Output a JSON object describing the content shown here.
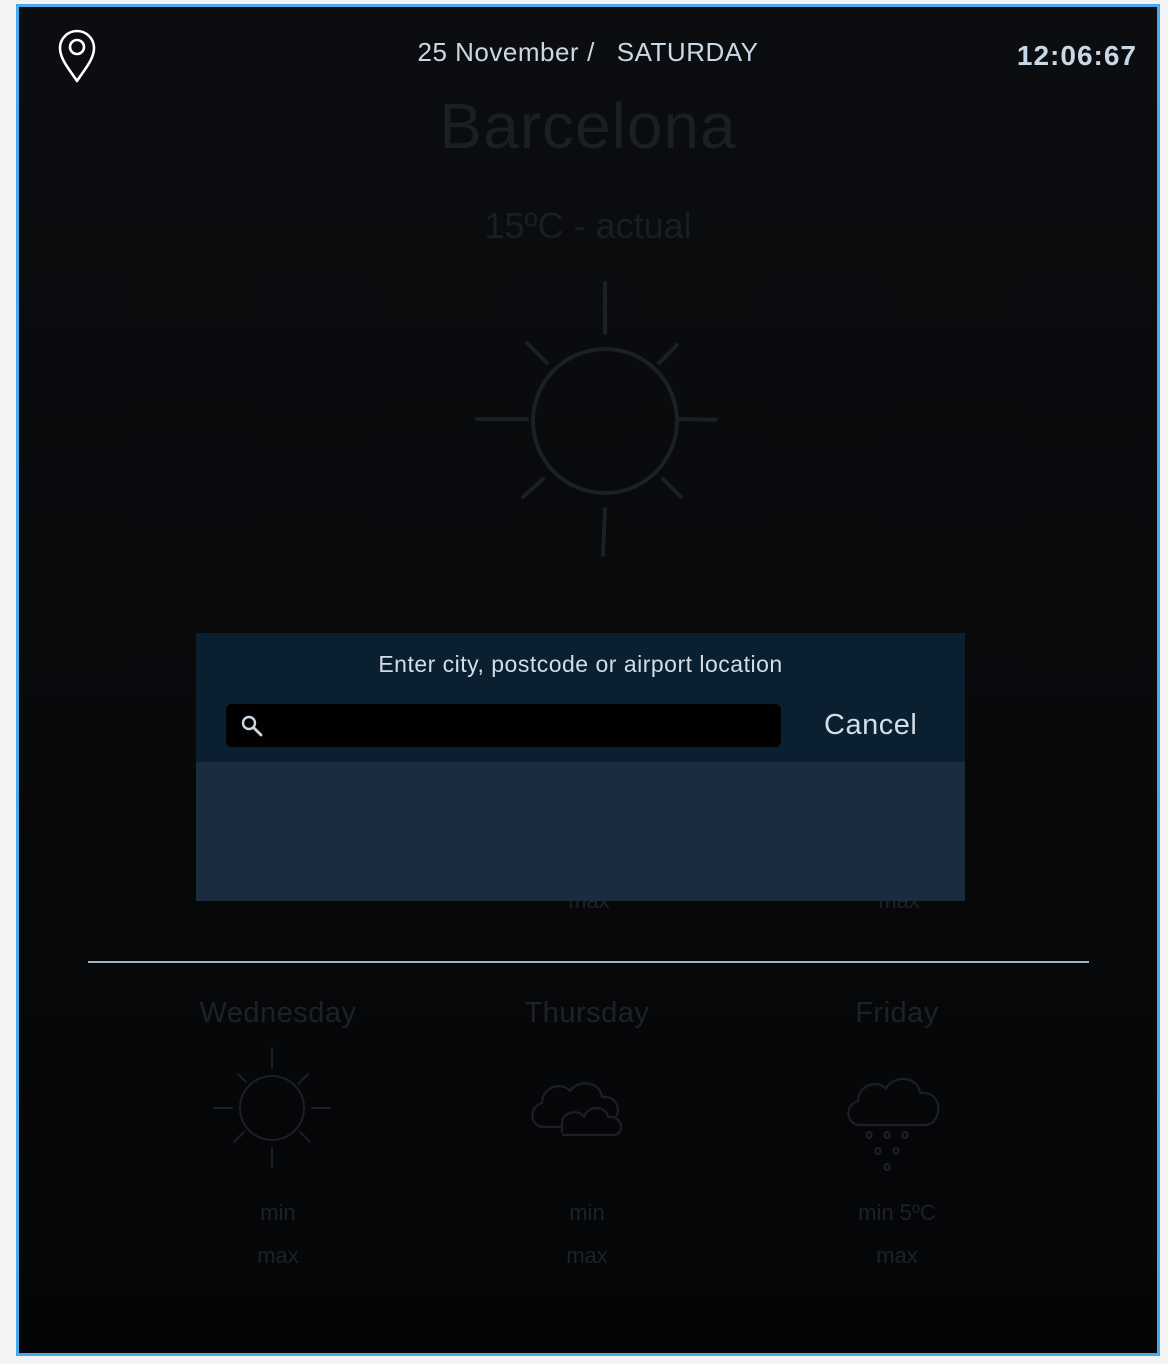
{
  "header": {
    "date": "25 November",
    "separator": "/",
    "day": "SATURDAY",
    "clock": "12:06:67"
  },
  "current": {
    "city": "Barcelona",
    "temperature": "15ºC - actual",
    "condition_icon": "sun-icon"
  },
  "search_modal": {
    "title": "Enter city, postcode or airport location",
    "search_value": "",
    "cancel_label": "Cancel"
  },
  "hidden_labels": {
    "left": "max",
    "right": "max"
  },
  "forecast": [
    {
      "day": "Wednesday",
      "icon": "sun-icon",
      "min_label": "min",
      "max_label": "max"
    },
    {
      "day": "Thursday",
      "icon": "cloud-icon",
      "min_label": "min",
      "max_label": "max"
    },
    {
      "day": "Friday",
      "icon": "rain-cloud-icon",
      "min_label": "min 5ºC",
      "max_label": "max"
    }
  ],
  "colors": {
    "frame_border": "#4aa8ec",
    "modal_header": "#0a1f2f",
    "modal_body": "#1a2c3e",
    "text_light": "#c9d8e6",
    "dimmed_text": "#1e2125"
  }
}
